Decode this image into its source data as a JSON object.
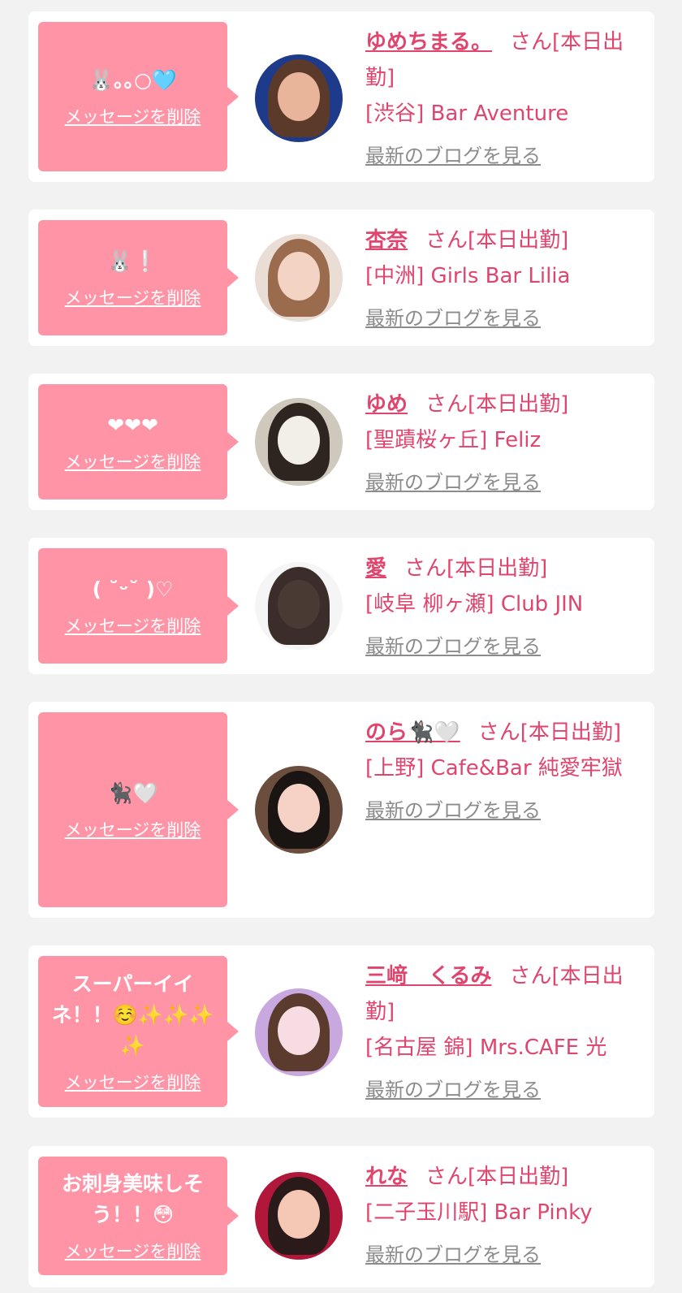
{
  "cards": [
    {
      "message": "🐰｡｡○🩵",
      "delete_label": "メッセージを削除",
      "name": "ゆめちまる。",
      "status": "さん[本日出勤]",
      "location": "[渋谷] Bar Aventure",
      "blog_link": "最新のブログを見る",
      "avatar_colors": [
        "#1e3a8a",
        "#5b3a2a",
        "#e8b49a"
      ]
    },
    {
      "message": "🐰❕",
      "delete_label": "メッセージを削除",
      "name": "杏奈",
      "status": "さん[本日出勤]",
      "location": "[中洲] Girls Bar Lilia",
      "blog_link": "最新のブログを見る",
      "avatar_colors": [
        "#e9ddd6",
        "#9a6b4d",
        "#f3d3c4"
      ]
    },
    {
      "message": "❤❤❤",
      "delete_label": "メッセージを削除",
      "name": "ゆめ",
      "status": "さん[本日出勤]",
      "location": "[聖蹟桜ヶ丘] Feliz",
      "blog_link": "最新のブログを見る",
      "avatar_colors": [
        "#cfc8bd",
        "#2e2420",
        "#f2efe9"
      ]
    },
    {
      "message": "( ˘ᵕ˘ )♡",
      "delete_label": "メッセージを削除",
      "name": "愛",
      "status": "さん[本日出勤]",
      "location": "[岐阜 柳ヶ瀬] Club JIN",
      "blog_link": "最新のブログを見る",
      "avatar_colors": [
        "#f5f5f5",
        "#3b2e2a",
        "#4a3a34"
      ]
    },
    {
      "message": "🐈‍⬛🤍",
      "delete_label": "メッセージを削除",
      "name": "のら🐈‍⬛🤍",
      "status": "さん[本日出勤]",
      "location": "[上野] Cafe&Bar 純愛牢獄",
      "blog_link": "最新のブログを見る",
      "avatar_colors": [
        "#6b4e3d",
        "#1a1412",
        "#f6d2c6"
      ]
    },
    {
      "message": "スーパーイイネ！！☺️✨✨✨✨",
      "delete_label": "メッセージを削除",
      "name": "三﨑　くるみ",
      "status": "さん[本日出勤]",
      "location": "[名古屋 錦] Mrs.CAFE 光",
      "blog_link": "最新のブログを見る",
      "avatar_colors": [
        "#c9a8e0",
        "#5a3b2e",
        "#f7dde3"
      ]
    },
    {
      "message": "お刺身美味しそう！！😳",
      "delete_label": "メッセージを削除",
      "name": "れな",
      "status": "さん[本日出勤]",
      "location": "[二子玉川駅] Bar Pinky",
      "blog_link": "最新のブログを見る",
      "avatar_colors": [
        "#b0173a",
        "#2a1a1a",
        "#f5c7b5"
      ]
    }
  ]
}
